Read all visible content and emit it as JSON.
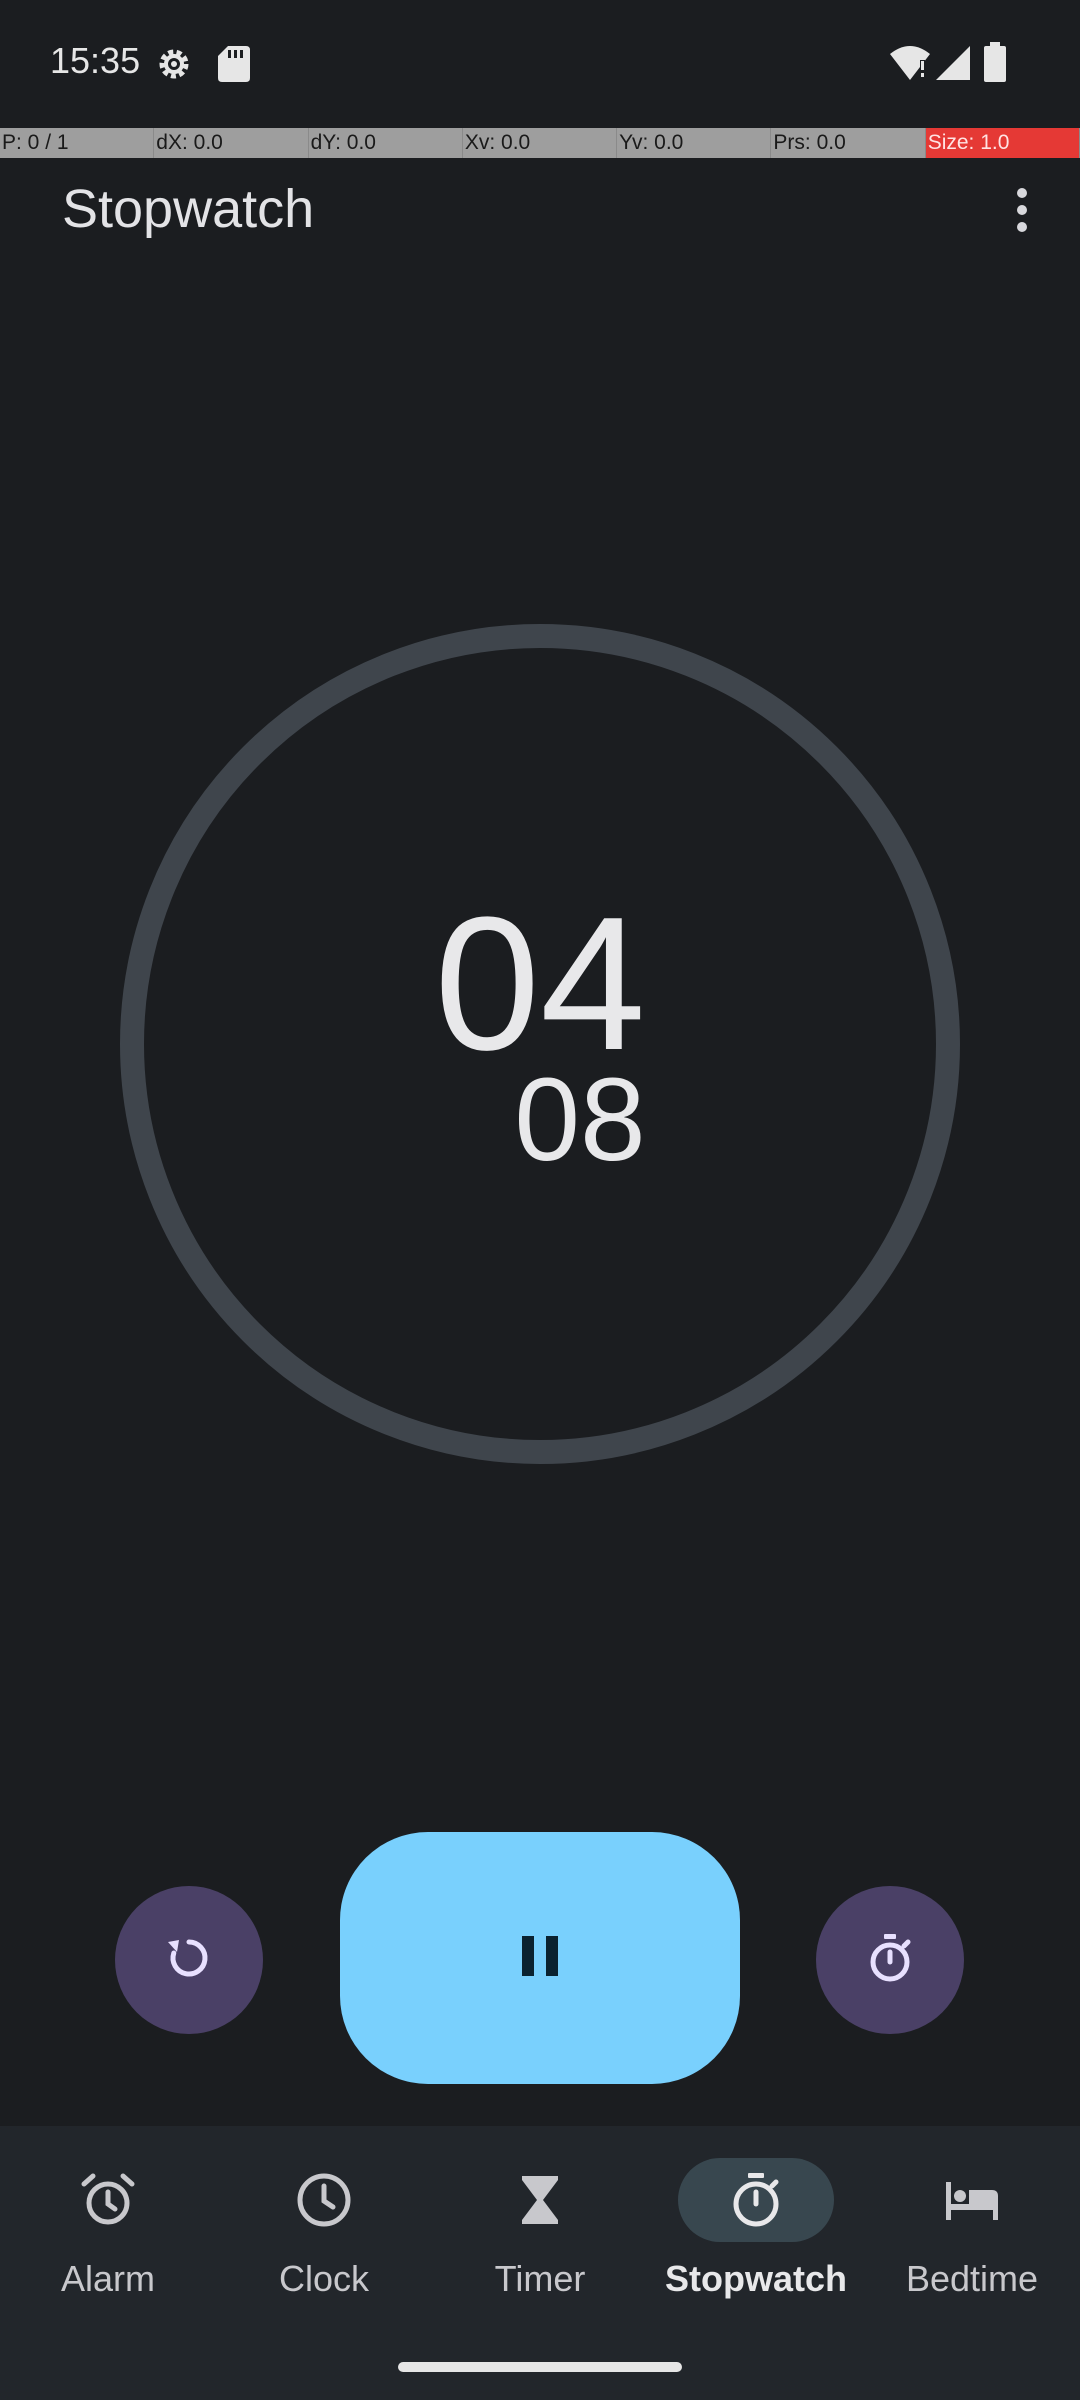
{
  "status_bar": {
    "time": "15:35",
    "icons": [
      "settings-gear-icon",
      "sd-card-icon",
      "wifi-alert-icon",
      "cell-signal-icon",
      "battery-icon"
    ]
  },
  "pointer_info": {
    "p": "P: 0 / 1",
    "dx": "dX: 0.0",
    "dy": "dY: 0.0",
    "xv": "Xv: 0.0",
    "yv": "Yv: 0.0",
    "prs": "Prs: 0.0",
    "size": "Size: 1.0"
  },
  "header": {
    "title": "Stopwatch",
    "menu_icon": "more-vert-icon"
  },
  "stopwatch": {
    "seconds": "04",
    "hundredths": "08"
  },
  "controls": {
    "reset_icon": "reset-icon",
    "pause_icon": "pause-icon",
    "lap_icon": "lap-timer-icon"
  },
  "colors": {
    "background": "#1b1d20",
    "accent": "#79d0fd",
    "secondary_button": "#4a4066",
    "dial_ring": "#3f454c"
  },
  "bottom_nav": {
    "items": [
      {
        "label": "Alarm",
        "icon": "alarm-icon",
        "active": false
      },
      {
        "label": "Clock",
        "icon": "clock-icon",
        "active": false
      },
      {
        "label": "Timer",
        "icon": "hourglass-icon",
        "active": false
      },
      {
        "label": "Stopwatch",
        "icon": "stopwatch-icon",
        "active": true
      },
      {
        "label": "Bedtime",
        "icon": "bed-icon",
        "active": false
      }
    ]
  }
}
